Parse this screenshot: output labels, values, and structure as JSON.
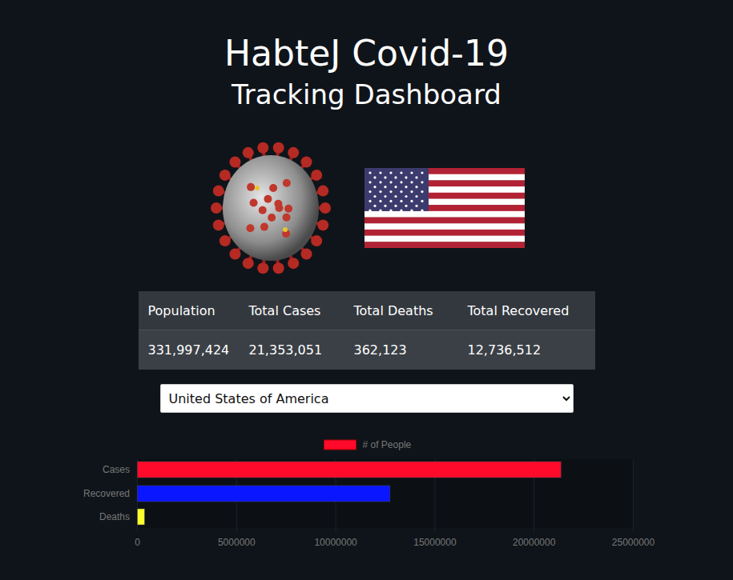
{
  "title": "HabteJ Covid-19",
  "subtitle": "Tracking Dashboard",
  "table": {
    "columns": [
      "Population",
      "Total Cases",
      "Total Deaths",
      "Total Recovered"
    ],
    "rows": [
      [
        "331,997,424",
        "21,353,051",
        "362,123",
        "12,736,512"
      ]
    ]
  },
  "select": {
    "value": "United States of America"
  },
  "chart": {
    "legend": "# of People",
    "legend_color": "#ff0a2b",
    "bars": [
      {
        "label": "Cases",
        "value": 21353051,
        "color": "#ff0a2b"
      },
      {
        "label": "Recovered",
        "value": 12736512,
        "color": "#0a16ff"
      },
      {
        "label": "Deaths",
        "value": 362123,
        "color": "#ffff2e"
      }
    ],
    "ticks": [
      "0",
      "5000000",
      "10000000",
      "15000000",
      "20000000",
      "25000000"
    ]
  }
}
